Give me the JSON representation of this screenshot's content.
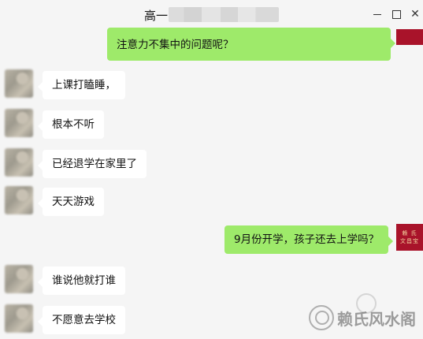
{
  "window": {
    "title_prefix": "高一",
    "controls": {
      "minimize": "minimize",
      "maximize": "maximize",
      "close": "close"
    }
  },
  "messages": [
    {
      "side": "out",
      "text": "注意力不集中的问题呢？"
    },
    {
      "side": "in",
      "text": "上课打瞌睡，"
    },
    {
      "side": "in",
      "text": "根本不听"
    },
    {
      "side": "in",
      "text": "已经退学在家里了"
    },
    {
      "side": "in",
      "text": "天天游戏"
    },
    {
      "side": "out",
      "text": "9月份开学，孩子还去上学吗？"
    },
    {
      "side": "in",
      "text": "谁说他就打谁"
    },
    {
      "side": "in",
      "text": "不愿意去学校"
    }
  ],
  "right_avatar": {
    "line1": "文昌宝",
    "line2": "赖 氏",
    "line3": "文昌宝"
  },
  "watermark": {
    "text": "赖氏风水阁"
  },
  "colors": {
    "outgoing_bubble": "#9eea6a",
    "incoming_bubble": "#ffffff",
    "background": "#f5f5f5",
    "seal": "#a9132a"
  }
}
